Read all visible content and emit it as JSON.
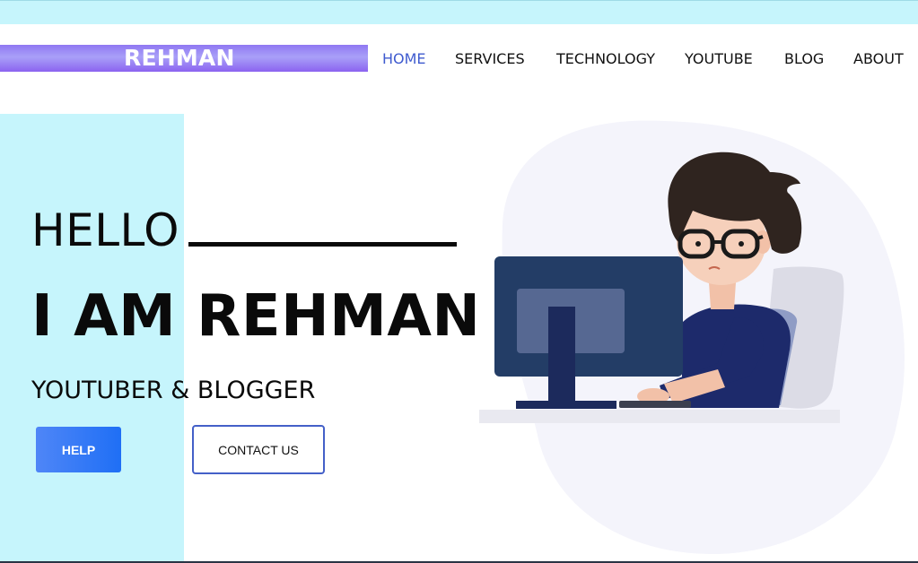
{
  "brand": {
    "name": "REHMAN"
  },
  "nav": {
    "items": [
      {
        "label": "HOME",
        "active": true
      },
      {
        "label": "SERVICES",
        "active": false
      },
      {
        "label": "TECHNOLOGY",
        "active": false
      },
      {
        "label": "YOUTUBE",
        "active": false
      },
      {
        "label": "BLOG",
        "active": false
      },
      {
        "label": "ABOUT",
        "active": false
      }
    ]
  },
  "hero": {
    "greeting": "HELLO",
    "headline": "I AM REHMAN",
    "subtitle": "YOUTUBER & BLOGGER",
    "help_label": "HELP",
    "contact_label": "CONTACT US",
    "illustration": "developer-at-computer-illustration"
  },
  "colors": {
    "accent_cyan": "#c6f5fc",
    "brand_purple": "#8b63f0",
    "nav_active": "#3f5bcf",
    "button_blue": "#1f6ff5"
  }
}
